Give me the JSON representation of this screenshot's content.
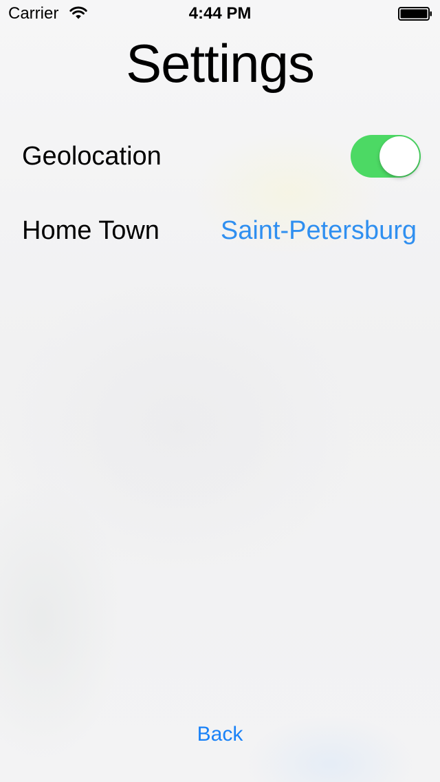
{
  "status_bar": {
    "carrier": "Carrier",
    "time": "4:44 PM",
    "wifi_icon": "wifi-icon",
    "battery_icon": "battery-icon"
  },
  "page": {
    "title": "Settings"
  },
  "settings": {
    "geolocation": {
      "label": "Geolocation",
      "enabled": true,
      "toggle_color": "#4cd964"
    },
    "home_town": {
      "label": "Home Town",
      "value": "Saint-Petersburg",
      "value_color": "#2f8ff0"
    }
  },
  "footer": {
    "back_label": "Back",
    "back_color": "#1a82f7"
  }
}
